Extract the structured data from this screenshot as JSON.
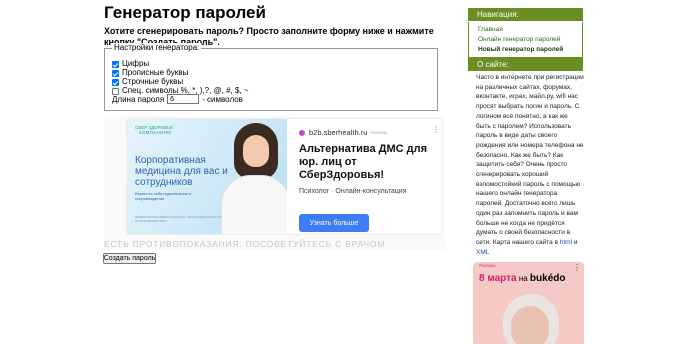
{
  "page": {
    "title": "Генератор паролей",
    "intro": "Хотите сгенерировать пароль? Просто заполните форму ниже и нажмите кнопку \"Создать пароль\"."
  },
  "settings": {
    "legend": "Настройки генератора:",
    "options": [
      {
        "label": "Цифры",
        "checked": true
      },
      {
        "label": "Прописные буквы",
        "checked": true
      },
      {
        "label": "Строчные буквы",
        "checked": true
      },
      {
        "label": "Спец. символы %, *, ),?, @, #, $, ~",
        "checked": false
      }
    ],
    "length_label": "Длина пароля",
    "length_value": "6",
    "length_suffix": "- символов"
  },
  "ad": {
    "image_brand": "СБЕР ЗДОРОВЬЕ",
    "image_brand2": "КОМПАНИЯМ",
    "image_headline": "Корпоративная медицина для вас и сотрудников",
    "image_sub": "Берем на себя подключение и сопровождение",
    "image_fine": "ИМЕЮТСЯ ПРОТИВОПОКАЗАНИЯ. НЕОБХОДИМА КОНСУЛЬТАЦИЯ СО СПЕЦИАЛИСТОМ",
    "domain": "b2b.sberhealth.ru",
    "label": "РЕКЛАМА",
    "menu": "⋮",
    "headline": "Альтернатива ДМС для юр. лиц от СберЗдоровья!",
    "description": "Психолог · Онлайн-консультация",
    "cta": "Узнать больше",
    "disclaimer": "ЕСТЬ ПРОТИВОПОКАЗАНИЯ. ПОСОВЕТУЙТЕСЬ С ВРАЧОМ"
  },
  "form": {
    "submit_label": "Создать пароль"
  },
  "sidebar": {
    "nav_title": "Навигация:",
    "nav_links": [
      "Главная",
      "Онлайн генератор паролей",
      "Новый генератор паролей"
    ],
    "about_title": "О сайте:",
    "about_text": "Часто в интернете при регистрации на различных сайтах, форумах, вконтакте, играх, майл.ру, wifi нас просят выбрать логин и пароль. С логином всё понятно, а как же быть с паролем? Использовать пароль в виде даты своего рождения или номера телефона не безопасно. Как же быть? Как защитить себя? Очень просто сгенерировать хороший взломостойкий пароль с помощью нашего онлайн генератора паролей. Достаточно всего лишь один раз запомнить пароль и вам больше не когда не придётся думать о своей безопасности в сети. Карта нашего сайта в ",
    "about_link1": "html",
    "about_and": " и ",
    "about_link2": "XML",
    "ad_label": "РЕКЛАМА",
    "ad_menu": "⋮",
    "ad_title_pre": "8 марта",
    "ad_title_mid": " на ",
    "ad_title_brand": "bukédo"
  },
  "colors": {
    "sidebar_header": "#6b8e23",
    "cta": "#3d7ef6",
    "checkbox": "#0075ff"
  }
}
